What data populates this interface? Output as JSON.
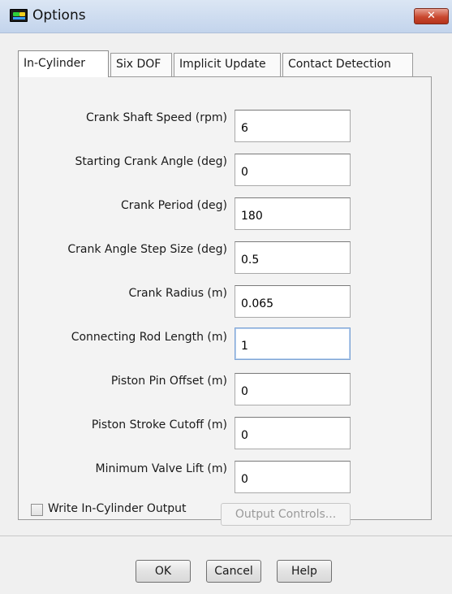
{
  "window": {
    "title": "Options",
    "close_label": "✕"
  },
  "tabs": [
    {
      "label": "In-Cylinder",
      "active": true
    },
    {
      "label": "Six DOF",
      "active": false
    },
    {
      "label": "Implicit Update",
      "active": false
    },
    {
      "label": "Contact Detection",
      "active": false
    }
  ],
  "fields": [
    {
      "label": "Crank Shaft Speed (rpm)",
      "value": "6"
    },
    {
      "label": "Starting Crank Angle (deg)",
      "value": "0"
    },
    {
      "label": "Crank Period (deg)",
      "value": "180"
    },
    {
      "label": "Crank Angle Step Size (deg)",
      "value": "0.5"
    },
    {
      "label": "Crank Radius (m)",
      "value": "0.065"
    },
    {
      "label": "Connecting Rod Length (m)",
      "value": "1"
    },
    {
      "label": "Piston Pin Offset (m)",
      "value": "0"
    },
    {
      "label": "Piston Stroke Cutoff (m)",
      "value": "0"
    },
    {
      "label": "Minimum Valve Lift (m)",
      "value": "0"
    }
  ],
  "write_output": {
    "label": "Write In-Cylinder Output",
    "checked": false
  },
  "output_controls_label": "Output Controls...",
  "buttons": {
    "ok": "OK",
    "cancel": "Cancel",
    "help": "Help"
  }
}
